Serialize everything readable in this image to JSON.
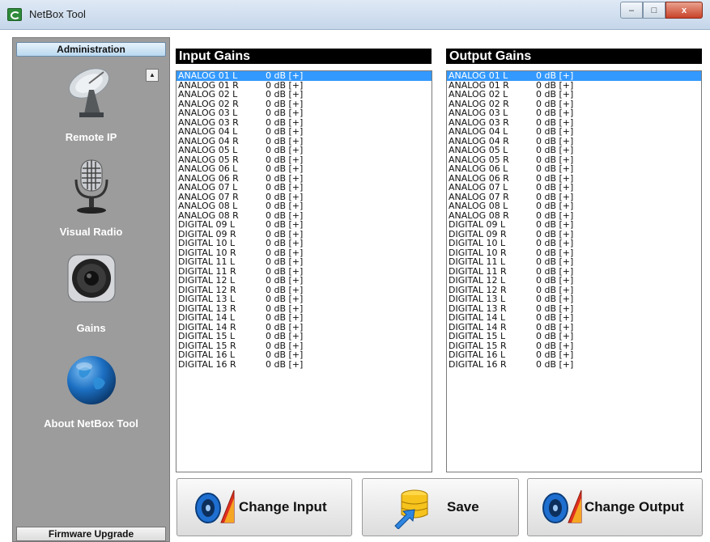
{
  "window": {
    "title": "NetBox Tool",
    "minimize": "‒",
    "maximize": "□",
    "close": "x"
  },
  "sidebar": {
    "header": "Administration",
    "footer": "Firmware Upgrade",
    "scroll_up": "▲",
    "items": [
      {
        "label": "Remote IP",
        "icon": "satellite-dish-icon"
      },
      {
        "label": "Visual Radio",
        "icon": "microphone-icon"
      },
      {
        "label": "Gains",
        "icon": "speaker-icon"
      },
      {
        "label": "About NetBox Tool",
        "icon": "globe-icon"
      }
    ]
  },
  "input_gains": {
    "title": "Input Gains",
    "selected_index": 0,
    "rows": [
      {
        "name": "ANALOG 01 L",
        "value": "0 dB [+]"
      },
      {
        "name": "ANALOG 01 R",
        "value": "0 dB [+]"
      },
      {
        "name": "ANALOG 02 L",
        "value": "0 dB [+]"
      },
      {
        "name": "ANALOG 02 R",
        "value": "0 dB [+]"
      },
      {
        "name": "ANALOG 03 L",
        "value": "0 dB [+]"
      },
      {
        "name": "ANALOG 03 R",
        "value": "0 dB [+]"
      },
      {
        "name": "ANALOG 04 L",
        "value": "0 dB [+]"
      },
      {
        "name": "ANALOG 04 R",
        "value": "0 dB [+]"
      },
      {
        "name": "ANALOG 05 L",
        "value": "0 dB [+]"
      },
      {
        "name": "ANALOG 05 R",
        "value": "0 dB [+]"
      },
      {
        "name": "ANALOG 06 L",
        "value": "0 dB [+]"
      },
      {
        "name": "ANALOG 06 R",
        "value": "0 dB [+]"
      },
      {
        "name": "ANALOG 07 L",
        "value": "0 dB [+]"
      },
      {
        "name": "ANALOG 07 R",
        "value": "0 dB [+]"
      },
      {
        "name": "ANALOG 08 L",
        "value": "0 dB [+]"
      },
      {
        "name": "ANALOG 08 R",
        "value": "0 dB [+]"
      },
      {
        "name": "DIGITAL 09 L",
        "value": "0 dB [+]"
      },
      {
        "name": "DIGITAL 09 R",
        "value": "0 dB [+]"
      },
      {
        "name": "DIGITAL 10 L",
        "value": "0 dB [+]"
      },
      {
        "name": "DIGITAL 10 R",
        "value": "0 dB [+]"
      },
      {
        "name": "DIGITAL 11 L",
        "value": "0 dB [+]"
      },
      {
        "name": "DIGITAL 11 R",
        "value": "0 dB [+]"
      },
      {
        "name": "DIGITAL 12 L",
        "value": "0 dB [+]"
      },
      {
        "name": "DIGITAL 12 R",
        "value": "0 dB [+]"
      },
      {
        "name": "DIGITAL 13 L",
        "value": "0 dB [+]"
      },
      {
        "name": "DIGITAL 13 R",
        "value": "0 dB [+]"
      },
      {
        "name": "DIGITAL 14 L",
        "value": "0 dB [+]"
      },
      {
        "name": "DIGITAL 14 R",
        "value": "0 dB [+]"
      },
      {
        "name": "DIGITAL 15 L",
        "value": "0 dB [+]"
      },
      {
        "name": "DIGITAL 15 R",
        "value": "0 dB [+]"
      },
      {
        "name": "DIGITAL 16 L",
        "value": "0 dB [+]"
      },
      {
        "name": "DIGITAL 16 R",
        "value": "0 dB [+]"
      }
    ]
  },
  "output_gains": {
    "title": "Output Gains",
    "selected_index": 0,
    "rows": [
      {
        "name": "ANALOG 01 L",
        "value": "0 dB [+]"
      },
      {
        "name": "ANALOG 01 R",
        "value": "0 dB [+]"
      },
      {
        "name": "ANALOG 02 L",
        "value": "0 dB [+]"
      },
      {
        "name": "ANALOG 02 R",
        "value": "0 dB [+]"
      },
      {
        "name": "ANALOG 03 L",
        "value": "0 dB [+]"
      },
      {
        "name": "ANALOG 03 R",
        "value": "0 dB [+]"
      },
      {
        "name": "ANALOG 04 L",
        "value": "0 dB [+]"
      },
      {
        "name": "ANALOG 04 R",
        "value": "0 dB [+]"
      },
      {
        "name": "ANALOG 05 L",
        "value": "0 dB [+]"
      },
      {
        "name": "ANALOG 05 R",
        "value": "0 dB [+]"
      },
      {
        "name": "ANALOG 06 L",
        "value": "0 dB [+]"
      },
      {
        "name": "ANALOG 06 R",
        "value": "0 dB [+]"
      },
      {
        "name": "ANALOG 07 L",
        "value": "0 dB [+]"
      },
      {
        "name": "ANALOG 07 R",
        "value": "0 dB [+]"
      },
      {
        "name": "ANALOG 08 L",
        "value": "0 dB [+]"
      },
      {
        "name": "ANALOG 08 R",
        "value": "0 dB [+]"
      },
      {
        "name": "DIGITAL 09 L",
        "value": "0 dB [+]"
      },
      {
        "name": "DIGITAL 09 R",
        "value": "0 dB [+]"
      },
      {
        "name": "DIGITAL 10 L",
        "value": "0 dB [+]"
      },
      {
        "name": "DIGITAL 10 R",
        "value": "0 dB [+]"
      },
      {
        "name": "DIGITAL 11 L",
        "value": "0 dB [+]"
      },
      {
        "name": "DIGITAL 11 R",
        "value": "0 dB [+]"
      },
      {
        "name": "DIGITAL 12 L",
        "value": "0 dB [+]"
      },
      {
        "name": "DIGITAL 12 R",
        "value": "0 dB [+]"
      },
      {
        "name": "DIGITAL 13 L",
        "value": "0 dB [+]"
      },
      {
        "name": "DIGITAL 13 R",
        "value": "0 dB [+]"
      },
      {
        "name": "DIGITAL 14 L",
        "value": "0 dB [+]"
      },
      {
        "name": "DIGITAL 14 R",
        "value": "0 dB [+]"
      },
      {
        "name": "DIGITAL 15 L",
        "value": "0 dB [+]"
      },
      {
        "name": "DIGITAL 15 R",
        "value": "0 dB [+]"
      },
      {
        "name": "DIGITAL 16 L",
        "value": "0 dB [+]"
      },
      {
        "name": "DIGITAL 16 R",
        "value": "0 dB [+]"
      }
    ]
  },
  "buttons": {
    "change_input": {
      "label": "Change Input",
      "icon": "speaker-volume-icon"
    },
    "save": {
      "label": "Save",
      "icon": "database-save-icon"
    },
    "change_output": {
      "label": "Change Output",
      "icon": "speaker-volume-icon"
    }
  },
  "colors": {
    "selection": "#3399ff",
    "sidebar_bg": "#9c9c9c",
    "header_bg": "#000000"
  }
}
